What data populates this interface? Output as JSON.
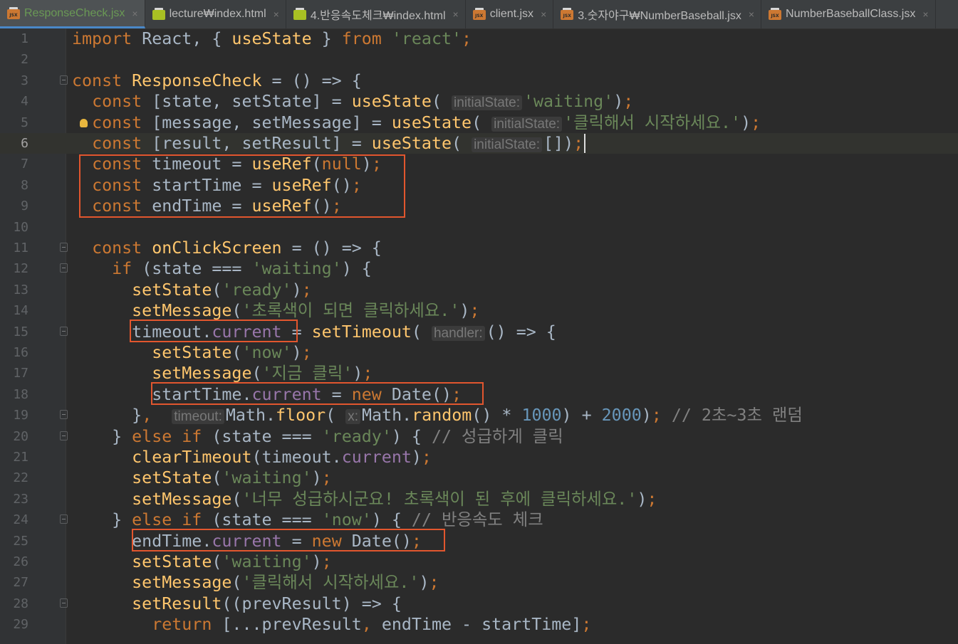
{
  "tabs": [
    {
      "label": "ResponseCheck.jsx",
      "icon": "jsx-file-icon",
      "active": true
    },
    {
      "label": "lecture₩index.html",
      "icon": "html-file-icon",
      "active": false
    },
    {
      "label": "4.반응속도체크₩index.html",
      "icon": "html-file-icon",
      "active": false
    },
    {
      "label": "client.jsx",
      "icon": "jsx-file-icon",
      "active": false
    },
    {
      "label": "3.숫자야구₩NumberBaseball.jsx",
      "icon": "jsx-file-icon",
      "active": false
    },
    {
      "label": "NumberBaseballClass.jsx",
      "icon": "jsx-file-icon",
      "active": false
    }
  ],
  "tab_close_glyph": "×",
  "file_icon_label": "JSX",
  "current_line": 6,
  "colors": {
    "background": "#2b2b2b",
    "keyword": "#cc7832",
    "function": "#ffc66d",
    "string": "#6a8759",
    "number": "#6897bb",
    "comment": "#808080",
    "property": "#9876aa",
    "highlight_box": "#e2562e"
  },
  "lines": [
    {
      "n": "1",
      "segs": [
        [
          "kw",
          "import "
        ],
        [
          "p",
          "React, { "
        ],
        [
          "fn",
          "useState"
        ],
        [
          "p",
          " } "
        ],
        [
          "kw",
          "from "
        ],
        [
          "str",
          "'react'"
        ],
        [
          "kw",
          ";"
        ]
      ]
    },
    {
      "n": "2",
      "segs": []
    },
    {
      "n": "3",
      "segs": [
        [
          "kw",
          "const "
        ],
        [
          "fn",
          "ResponseCheck"
        ],
        [
          "p",
          " = () => {"
        ]
      ]
    },
    {
      "n": "4",
      "segs": [
        [
          "p",
          "  "
        ],
        [
          "kw",
          "const "
        ],
        [
          "p",
          "[state, setState] = "
        ],
        [
          "fn",
          "useState"
        ],
        [
          "p",
          "( "
        ],
        [
          "hint",
          "initialState:"
        ],
        [
          "str",
          "'waiting'"
        ],
        [
          "p",
          ")"
        ],
        [
          "kw",
          ";"
        ]
      ]
    },
    {
      "n": "5",
      "segs": [
        [
          "p",
          "  "
        ],
        [
          "kw",
          "const "
        ],
        [
          "p",
          "[message, setMessage] = "
        ],
        [
          "fn",
          "useState"
        ],
        [
          "p",
          "( "
        ],
        [
          "hint",
          "initialState:"
        ],
        [
          "str",
          "'클릭해서 시작하세요.'"
        ],
        [
          "p",
          ")"
        ],
        [
          "kw",
          ";"
        ]
      ]
    },
    {
      "n": "6",
      "segs": [
        [
          "p",
          "  "
        ],
        [
          "kw",
          "const "
        ],
        [
          "p",
          "[result, setResult] = "
        ],
        [
          "fn",
          "useState"
        ],
        [
          "p",
          "( "
        ],
        [
          "hint",
          "initialState:"
        ],
        [
          "p",
          "[])"
        ],
        [
          "kw",
          ";"
        ],
        [
          "cursor",
          ""
        ]
      ]
    },
    {
      "n": "7",
      "segs": [
        [
          "p",
          "  "
        ],
        [
          "kw",
          "const "
        ],
        [
          "p",
          "timeout = "
        ],
        [
          "fn",
          "useRef"
        ],
        [
          "p",
          "("
        ],
        [
          "kw",
          "null"
        ],
        [
          "p",
          ")"
        ],
        [
          "kw",
          ";"
        ]
      ]
    },
    {
      "n": "8",
      "segs": [
        [
          "p",
          "  "
        ],
        [
          "kw",
          "const "
        ],
        [
          "p",
          "startTime = "
        ],
        [
          "fn",
          "useRef"
        ],
        [
          "p",
          "()"
        ],
        [
          "kw",
          ";"
        ]
      ]
    },
    {
      "n": "9",
      "segs": [
        [
          "p",
          "  "
        ],
        [
          "kw",
          "const "
        ],
        [
          "p",
          "endTime = "
        ],
        [
          "fn",
          "useRef"
        ],
        [
          "p",
          "()"
        ],
        [
          "kw",
          ";"
        ]
      ]
    },
    {
      "n": "10",
      "segs": []
    },
    {
      "n": "11",
      "segs": [
        [
          "p",
          "  "
        ],
        [
          "kw",
          "const "
        ],
        [
          "fn",
          "onClickScreen"
        ],
        [
          "p",
          " = () => {"
        ]
      ]
    },
    {
      "n": "12",
      "segs": [
        [
          "p",
          "    "
        ],
        [
          "kw",
          "if "
        ],
        [
          "p",
          "(state === "
        ],
        [
          "str",
          "'waiting'"
        ],
        [
          "p",
          ") {"
        ]
      ]
    },
    {
      "n": "13",
      "segs": [
        [
          "p",
          "      "
        ],
        [
          "fn",
          "setState"
        ],
        [
          "p",
          "("
        ],
        [
          "str",
          "'ready'"
        ],
        [
          "p",
          ")"
        ],
        [
          "kw",
          ";"
        ]
      ]
    },
    {
      "n": "14",
      "segs": [
        [
          "p",
          "      "
        ],
        [
          "fn",
          "setMessage"
        ],
        [
          "p",
          "("
        ],
        [
          "str",
          "'초록색이 되면 클릭하세요.'"
        ],
        [
          "p",
          ")"
        ],
        [
          "kw",
          ";"
        ]
      ]
    },
    {
      "n": "15",
      "segs": [
        [
          "p",
          "      timeout."
        ],
        [
          "prop",
          "current"
        ],
        [
          "p",
          " = "
        ],
        [
          "fn",
          "setTimeout"
        ],
        [
          "p",
          "( "
        ],
        [
          "hint",
          "handler:"
        ],
        [
          "p",
          "() => {"
        ]
      ]
    },
    {
      "n": "16",
      "segs": [
        [
          "p",
          "        "
        ],
        [
          "fn",
          "setState"
        ],
        [
          "p",
          "("
        ],
        [
          "str",
          "'now'"
        ],
        [
          "p",
          ")"
        ],
        [
          "kw",
          ";"
        ]
      ]
    },
    {
      "n": "17",
      "segs": [
        [
          "p",
          "        "
        ],
        [
          "fn",
          "setMessage"
        ],
        [
          "p",
          "("
        ],
        [
          "str",
          "'지금 클릭'"
        ],
        [
          "p",
          ")"
        ],
        [
          "kw",
          ";"
        ]
      ]
    },
    {
      "n": "18",
      "segs": [
        [
          "p",
          "        startTime."
        ],
        [
          "prop",
          "current"
        ],
        [
          "p",
          " = "
        ],
        [
          "kw",
          "new "
        ],
        [
          "p",
          "Date()"
        ],
        [
          "kw",
          ";"
        ]
      ]
    },
    {
      "n": "19",
      "segs": [
        [
          "p",
          "      }"
        ],
        [
          "kw",
          ","
        ],
        [
          "p",
          "  "
        ],
        [
          "hint",
          "timeout:"
        ],
        [
          "p",
          "Math."
        ],
        [
          "fn",
          "floor"
        ],
        [
          "p",
          "( "
        ],
        [
          "hint",
          "x:"
        ],
        [
          "p",
          "Math."
        ],
        [
          "fn",
          "random"
        ],
        [
          "p",
          "() * "
        ],
        [
          "num",
          "1000"
        ],
        [
          "p",
          ") + "
        ],
        [
          "num",
          "2000"
        ],
        [
          "p",
          ")"
        ],
        [
          "kw",
          ";"
        ],
        [
          "p",
          " "
        ],
        [
          "cm",
          "// 2초~3초 랜덤"
        ]
      ]
    },
    {
      "n": "20",
      "segs": [
        [
          "p",
          "    } "
        ],
        [
          "kw",
          "else if "
        ],
        [
          "p",
          "(state === "
        ],
        [
          "str",
          "'ready'"
        ],
        [
          "p",
          ") { "
        ],
        [
          "cm",
          "// 성급하게 클릭"
        ]
      ]
    },
    {
      "n": "21",
      "segs": [
        [
          "p",
          "      "
        ],
        [
          "fn",
          "clearTimeout"
        ],
        [
          "p",
          "(timeout."
        ],
        [
          "prop",
          "current"
        ],
        [
          "p",
          ")"
        ],
        [
          "kw",
          ";"
        ]
      ]
    },
    {
      "n": "22",
      "segs": [
        [
          "p",
          "      "
        ],
        [
          "fn",
          "setState"
        ],
        [
          "p",
          "("
        ],
        [
          "str",
          "'waiting'"
        ],
        [
          "p",
          ")"
        ],
        [
          "kw",
          ";"
        ]
      ]
    },
    {
      "n": "23",
      "segs": [
        [
          "p",
          "      "
        ],
        [
          "fn",
          "setMessage"
        ],
        [
          "p",
          "("
        ],
        [
          "str",
          "'너무 성급하시군요! 초록색이 된 후에 클릭하세요.'"
        ],
        [
          "p",
          ")"
        ],
        [
          "kw",
          ";"
        ]
      ]
    },
    {
      "n": "24",
      "segs": [
        [
          "p",
          "    } "
        ],
        [
          "kw",
          "else if "
        ],
        [
          "p",
          "(state === "
        ],
        [
          "str",
          "'now'"
        ],
        [
          "p",
          ") { "
        ],
        [
          "cm",
          "// 반응속도 체크"
        ]
      ]
    },
    {
      "n": "25",
      "segs": [
        [
          "p",
          "      endTime."
        ],
        [
          "prop",
          "current"
        ],
        [
          "p",
          " = "
        ],
        [
          "kw",
          "new "
        ],
        [
          "p",
          "Date()"
        ],
        [
          "kw",
          ";"
        ]
      ]
    },
    {
      "n": "26",
      "segs": [
        [
          "p",
          "      "
        ],
        [
          "fn",
          "setState"
        ],
        [
          "p",
          "("
        ],
        [
          "str",
          "'waiting'"
        ],
        [
          "p",
          ")"
        ],
        [
          "kw",
          ";"
        ]
      ]
    },
    {
      "n": "27",
      "segs": [
        [
          "p",
          "      "
        ],
        [
          "fn",
          "setMessage"
        ],
        [
          "p",
          "("
        ],
        [
          "str",
          "'클릭해서 시작하세요.'"
        ],
        [
          "p",
          ")"
        ],
        [
          "kw",
          ";"
        ]
      ]
    },
    {
      "n": "28",
      "segs": [
        [
          "p",
          "      "
        ],
        [
          "fn",
          "setResult"
        ],
        [
          "p",
          "((prevResult) => {"
        ]
      ]
    },
    {
      "n": "29",
      "segs": [
        [
          "p",
          "        "
        ],
        [
          "kw",
          "return "
        ],
        [
          "p",
          "[...prevResult"
        ],
        [
          "kw",
          ","
        ],
        [
          "p",
          " endTime - startTime]"
        ],
        [
          "kw",
          ";"
        ]
      ]
    }
  ]
}
